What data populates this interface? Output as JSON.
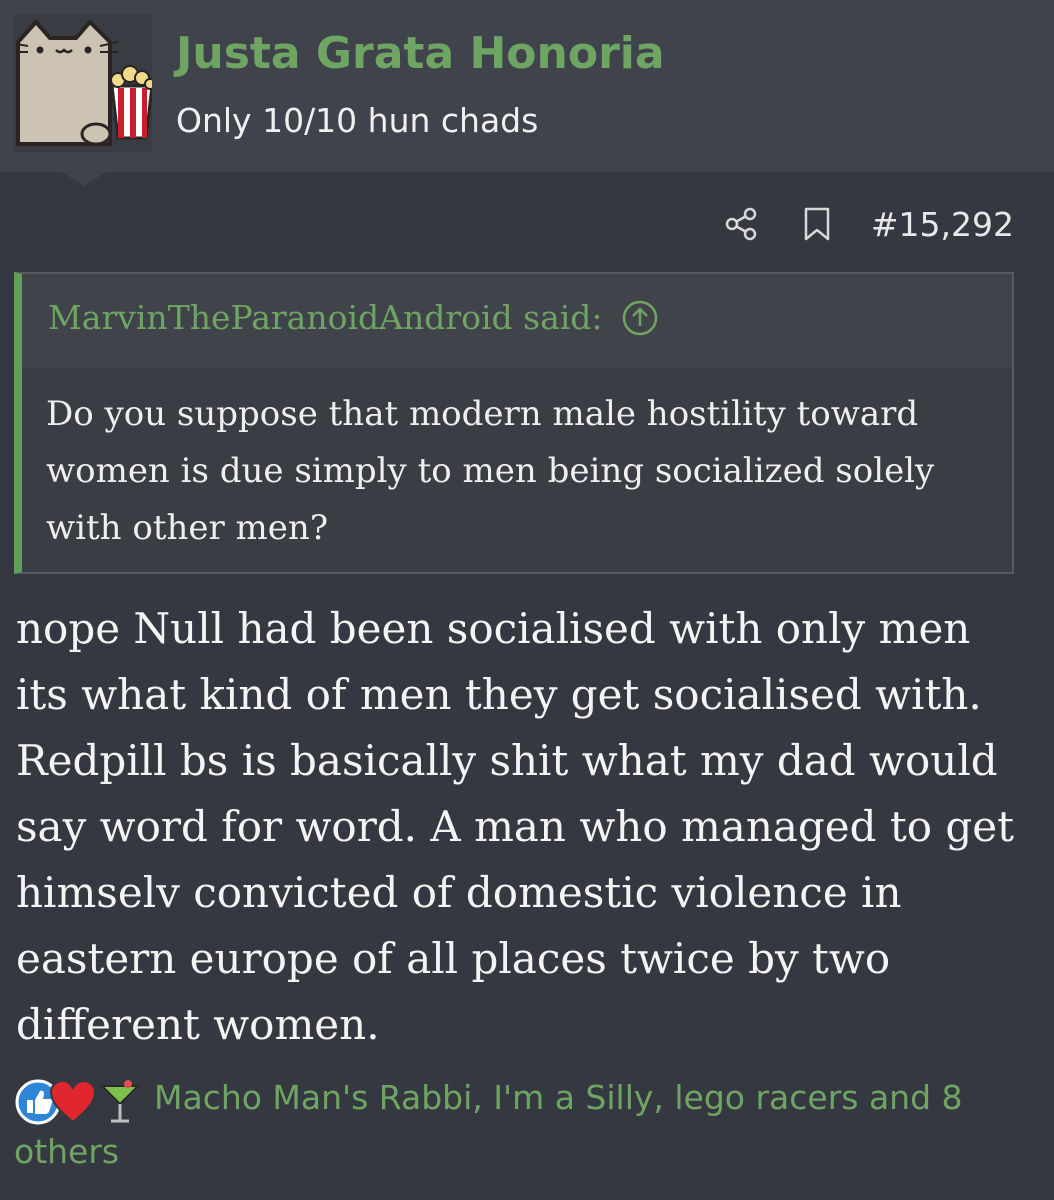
{
  "header": {
    "username": "Justa Grata Honoria",
    "user_title": "Only 10/10 hun chads",
    "avatar_icon": "cat-with-popcorn-icon"
  },
  "post_actions": {
    "share_icon": "share-icon",
    "bookmark_icon": "bookmark-icon",
    "post_number": "#15,292"
  },
  "quote": {
    "author": "MarvinTheParanoidAndroid said:",
    "jump_icon": "arrow-up-circle-icon",
    "text": "Do you suppose that modern male hostility toward women is due simply to men being socialized solely with other men?"
  },
  "message": {
    "text": "nope Null had been socialised with only men its what kind of men they get socialised with. Redpill bs is basically shit what my dad would say word for word. A man who managed to get himselv convicted of domestic violence in eastern europe of all places twice by two different women."
  },
  "reactions": {
    "icons": [
      "like-icon",
      "heart-icon",
      "cocktail-icon"
    ],
    "text": "Macho Man's Rabbi, I'm a Silly, lego racers and 8 others"
  },
  "colors": {
    "accent_green": "#6ea563",
    "quote_border": "#5f9f58",
    "background": "#353840",
    "header_bg": "#40434b"
  }
}
